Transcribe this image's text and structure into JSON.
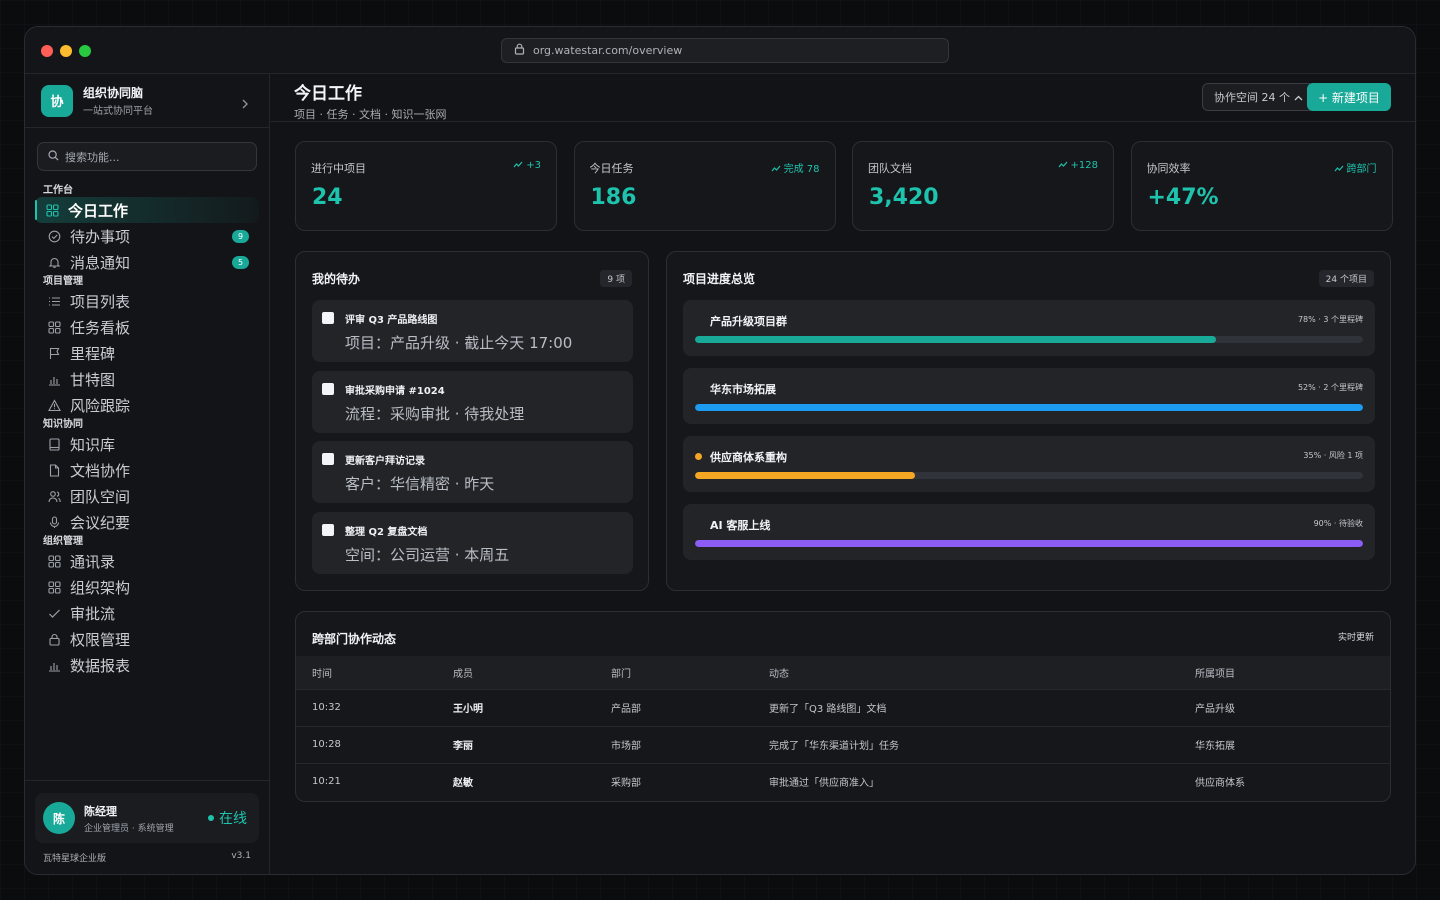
{
  "browser": {
    "url": "org.watestar.com/overview"
  },
  "brand": {
    "logo": "协",
    "name": "组织协同脑",
    "subtitle": "一站式协同平台"
  },
  "search": {
    "placeholder": "搜索功能..."
  },
  "nav": {
    "sections": [
      {
        "title": "工作台",
        "items": [
          {
            "label": "今日工作",
            "icon": "grid-icon",
            "active": true
          },
          {
            "label": "待办事项",
            "icon": "check-circle-icon",
            "badge": "9"
          },
          {
            "label": "消息通知",
            "icon": "bell-icon",
            "badge": "5"
          }
        ]
      },
      {
        "title": "项目管理",
        "items": [
          {
            "label": "项目列表",
            "icon": "list-icon"
          },
          {
            "label": "任务看板",
            "icon": "grid-icon"
          },
          {
            "label": "里程碑",
            "icon": "flag-icon"
          },
          {
            "label": "甘特图",
            "icon": "bar-chart-icon"
          },
          {
            "label": "风险跟踪",
            "icon": "warning-icon"
          }
        ]
      },
      {
        "title": "知识协同",
        "items": [
          {
            "label": "知识库",
            "icon": "book-icon"
          },
          {
            "label": "文档协作",
            "icon": "file-icon"
          },
          {
            "label": "团队空间",
            "icon": "users-icon"
          },
          {
            "label": "会议纪要",
            "icon": "mic-icon"
          }
        ]
      },
      {
        "title": "组织管理",
        "items": [
          {
            "label": "通讯录",
            "icon": "grid-icon"
          },
          {
            "label": "组织架构",
            "icon": "grid-icon"
          },
          {
            "label": "审批流",
            "icon": "check-icon"
          },
          {
            "label": "权限管理",
            "icon": "lock-icon"
          },
          {
            "label": "数据报表",
            "icon": "bar-chart-icon"
          }
        ]
      }
    ]
  },
  "user": {
    "avatar": "陈",
    "name": "陈经理",
    "role": "企业管理员 · 系统管理",
    "status": "在线"
  },
  "footer": {
    "edition": "瓦特星球企业版",
    "version": "v3.1"
  },
  "header": {
    "title": "今日工作",
    "subtitle": "项目 · 任务 · 文档 · 知识一张网",
    "space_button": "协作空间 24 个",
    "new_button": "+ 新建项目"
  },
  "stats": [
    {
      "label": "进行中项目",
      "delta": "+3",
      "value": "24"
    },
    {
      "label": "今日任务",
      "delta": "完成 78",
      "value": "186"
    },
    {
      "label": "团队文档",
      "delta": "+128",
      "value": "3,420"
    },
    {
      "label": "协同效率",
      "delta": "跨部门",
      "value": "+47%"
    }
  ],
  "todos": {
    "title": "我的待办",
    "count": "9 项",
    "items": [
      {
        "title": "评审 Q3 产品路线图",
        "detail": "项目：产品升级 · 截止今天 17:00"
      },
      {
        "title": "审批采购申请 #1024",
        "detail": "流程：采购审批 · 待我处理"
      },
      {
        "title": "更新客户拜访记录",
        "detail": "客户：华信精密 · 昨天"
      },
      {
        "title": "整理 Q2 复盘文档",
        "detail": "空间：公司运营 · 本周五"
      }
    ]
  },
  "projects": {
    "title": "项目进度总览",
    "count": "24 个项目",
    "items": [
      {
        "name": "产品升级项目群",
        "meta": "78% · 3 个里程碑",
        "progress": 0.78,
        "color": "#18a999"
      },
      {
        "name": "华东市场拓展",
        "meta": "52% · 2 个里程碑",
        "progress": 1.0,
        "color": "#1d9bf0"
      },
      {
        "name": "供应商体系重构",
        "meta": "35% · 风险 1 项",
        "progress": 0.33,
        "color": "#f5a623",
        "warning": true
      },
      {
        "name": "AI 客服上线",
        "meta": "90% · 待验收",
        "progress": 1.0,
        "color": "#8b5cf6"
      }
    ]
  },
  "activity": {
    "title": "跨部门协作动态",
    "live": "实时更新",
    "columns": [
      "时间",
      "成员",
      "部门",
      "动态",
      "所属项目"
    ],
    "rows": [
      [
        "10:32",
        "王小明",
        "产品部",
        "更新了「Q3 路线图」文档",
        "产品升级"
      ],
      [
        "10:28",
        "李丽",
        "市场部",
        "完成了「华东渠道计划」任务",
        "华东拓展"
      ],
      [
        "10:21",
        "赵敏",
        "采购部",
        "审批通过「供应商准入」",
        "供应商体系"
      ]
    ]
  },
  "colors": {
    "accent": "#18a999",
    "accent_bright": "#1ec3ad",
    "warning": "#f5a623",
    "blue": "#1d9bf0",
    "purple": "#8b5cf6"
  }
}
